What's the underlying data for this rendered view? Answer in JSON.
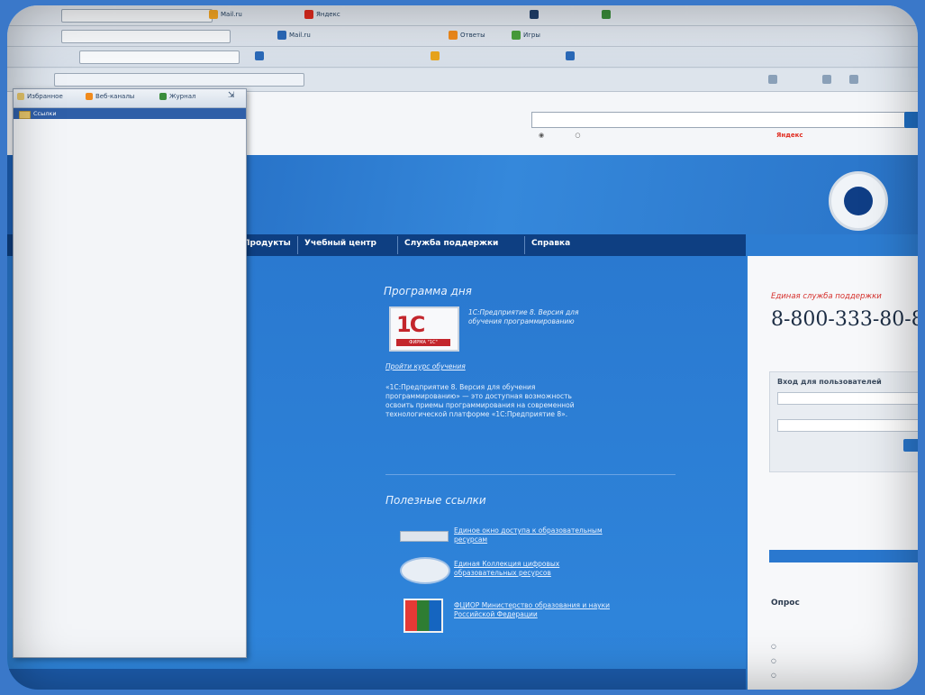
{
  "browser": {
    "toolbar_labels": [
      "Mail.ru",
      "Яндекс",
      "Ответы",
      "Игры"
    ]
  },
  "panel": {
    "tabs": [
      "Избранное",
      "Веб-каналы",
      "Журнал"
    ],
    "items": [
      "Ссылки"
    ]
  },
  "page": {
    "search_placeholder": "",
    "radio_internet": "",
    "radio_site": "",
    "yandex_label": "",
    "yandex_brand": "Яндекс",
    "nav": [
      "Продукты",
      "Учебный центр",
      "Служба поддержки",
      "Справка"
    ],
    "left_fragments": [],
    "program_of_day": {
      "title": "Программа дня",
      "logo_text": "1С",
      "logo_sub": "ФИРМА \"1С\"",
      "desc": [
        "1С:Предприятие 8. Версия для",
        "обучения программированию"
      ],
      "link": "Пройти курс обучения",
      "paragraph": [
        "«1С:Предприятие 8. Версия для обучения",
        "программированию» — это доступная возможность",
        "освоить приемы программирования на современной",
        "технологической платформе «1С:Предприятие 8»."
      ],
      "downloads_link": ""
    },
    "useful_links": {
      "title": "Полезные ссылки",
      "items": [
        [
          "Единое окно доступа к образовательным",
          "ресурсам"
        ],
        [
          "Единая Коллекция цифровых",
          "образовательных ресурсов"
        ],
        [
          "ФЦИОР Министерство образования и науки",
          "Российской Федерации"
        ]
      ]
    },
    "sidebar": {
      "top_link": "",
      "service_title": "Единая служба поддержки",
      "phone": "8-800-333-80-8",
      "phone_note": "",
      "login_title": "Вход для пользователей",
      "login_placeholder": "",
      "password_label": "",
      "forgot": [],
      "login_btn": "",
      "support_text": [],
      "support_btn": "",
      "poll_title": "Опрос",
      "poll_question": [],
      "poll_options": []
    },
    "footer_text": ""
  },
  "colors": {
    "banner_blue": "#2f86dc",
    "nav_dark": "#0e3f82",
    "accent_red": "#d6312d"
  }
}
